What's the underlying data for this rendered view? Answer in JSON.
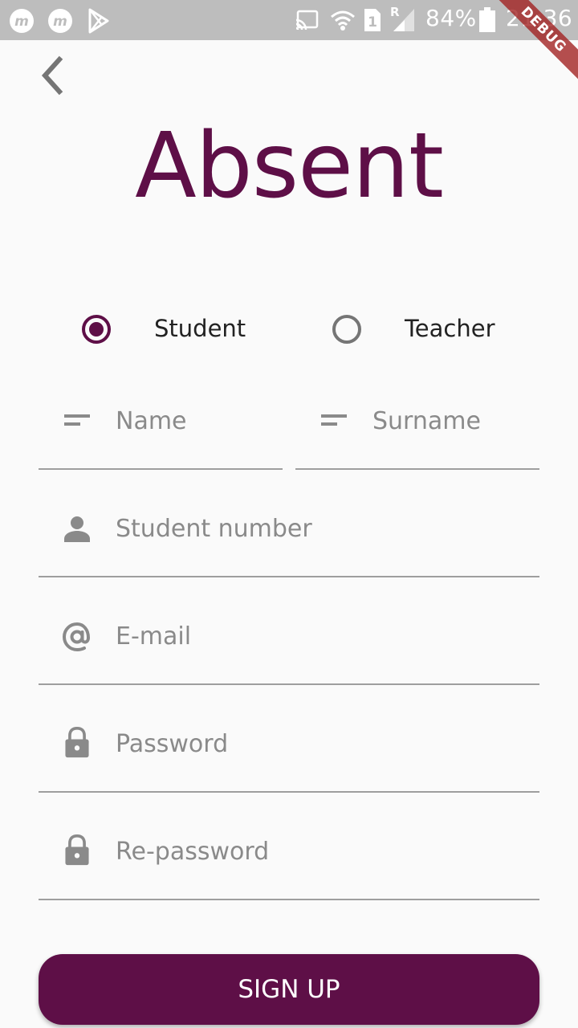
{
  "status_bar": {
    "battery": "84%",
    "time": "21:36",
    "sim_slot": "1",
    "roaming": "R",
    "debug_label": "DEBUG",
    "icons": [
      "m-app-icon",
      "m-app-icon",
      "play-store-icon",
      "cast-icon",
      "wifi-icon",
      "sim-icon",
      "signal-icon",
      "battery-icon"
    ]
  },
  "header": {
    "back_icon": "chevron-left-icon",
    "title": "Absent"
  },
  "role": {
    "options": [
      {
        "label": "Student",
        "selected": true
      },
      {
        "label": "Teacher",
        "selected": false
      }
    ]
  },
  "form": {
    "name_placeholder": "Name",
    "surname_placeholder": "Surname",
    "student_number_placeholder": "Student number",
    "email_placeholder": "E-mail",
    "password_placeholder": "Password",
    "repassword_placeholder": "Re-password"
  },
  "actions": {
    "signup_label": "SIGN UP"
  },
  "colors": {
    "accent": "#5e0f47",
    "background": "#fafafa",
    "status_bar": "#bdbdbd",
    "placeholder": "#8a8a8a"
  }
}
